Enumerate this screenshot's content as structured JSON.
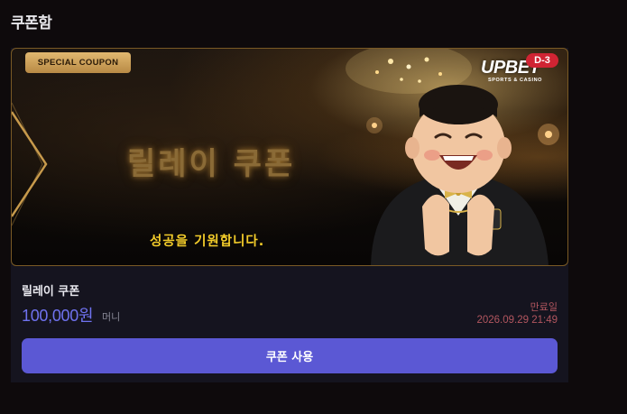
{
  "page": {
    "title": "쿠폰함"
  },
  "coupon": {
    "banner": {
      "tag_label": "SPECIAL COUPON",
      "brand_name": "UPBET",
      "brand_tagline": "SPORTS & CASINO",
      "dday_badge": "D-3",
      "title": "릴레이 쿠폰",
      "subtitle": "성공을 기원합니다."
    },
    "name": "릴레이 쿠폰",
    "amount": "100,000원",
    "unit": "머니",
    "expiry_label": "만료일",
    "expiry_date": "2026.09.29 21:49",
    "use_button_label": "쿠폰 사용"
  },
  "colors": {
    "background": "#0e0a0c",
    "card": "#15141f",
    "accent": "#5b58d4",
    "amount": "#6f72ef",
    "expiry": "#b2565f",
    "gold": "#f3cc2a"
  },
  "icons": {
    "banner_arrow": "chevron-right-icon",
    "mascot": "mascot-illustration"
  }
}
